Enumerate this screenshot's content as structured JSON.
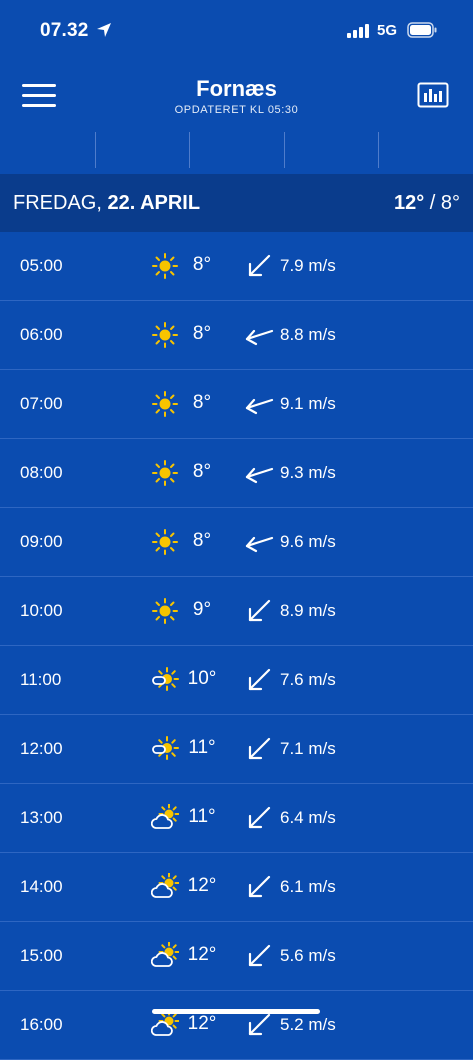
{
  "status_bar": {
    "time": "07.32",
    "network": "5G"
  },
  "header": {
    "title": "Fornæs",
    "subtitle": "OPDATERET KL 05:30",
    "menu_icon": "hamburger-icon",
    "chart_icon": "bar-chart-icon"
  },
  "day": {
    "name": "FREDAG, ",
    "date": "22. APRIL",
    "high": "12°",
    "separator": " / ",
    "low": "8°"
  },
  "colors": {
    "background": "#0b4cb0",
    "day_bar": "#0a3c8c",
    "row_divider": "#2e66c2",
    "sun": "#f7c400"
  },
  "hours": [
    {
      "time": "05:00",
      "icon": "sun-icon",
      "temp": "8°",
      "wind_dir": "southwest",
      "wind": "7.9 m/s"
    },
    {
      "time": "06:00",
      "icon": "sun-icon",
      "temp": "8°",
      "wind_dir": "west-southwest",
      "wind": "8.8 m/s"
    },
    {
      "time": "07:00",
      "icon": "sun-icon",
      "temp": "8°",
      "wind_dir": "west-southwest",
      "wind": "9.1 m/s"
    },
    {
      "time": "08:00",
      "icon": "sun-icon",
      "temp": "8°",
      "wind_dir": "west-southwest",
      "wind": "9.3 m/s"
    },
    {
      "time": "09:00",
      "icon": "sun-icon",
      "temp": "8°",
      "wind_dir": "west-southwest",
      "wind": "9.6 m/s"
    },
    {
      "time": "10:00",
      "icon": "sun-icon",
      "temp": "9°",
      "wind_dir": "southwest",
      "wind": "8.9 m/s"
    },
    {
      "time": "11:00",
      "icon": "sun-cloud-icon",
      "temp": "10°",
      "wind_dir": "southwest",
      "wind": "7.6 m/s"
    },
    {
      "time": "12:00",
      "icon": "sun-cloud-icon",
      "temp": "11°",
      "wind_dir": "southwest",
      "wind": "7.1 m/s"
    },
    {
      "time": "13:00",
      "icon": "partly-cloudy-icon",
      "temp": "11°",
      "wind_dir": "southwest",
      "wind": "6.4 m/s"
    },
    {
      "time": "14:00",
      "icon": "partly-cloudy-icon",
      "temp": "12°",
      "wind_dir": "southwest",
      "wind": "6.1 m/s"
    },
    {
      "time": "15:00",
      "icon": "partly-cloudy-icon",
      "temp": "12°",
      "wind_dir": "southwest",
      "wind": "5.6 m/s"
    },
    {
      "time": "16:00",
      "icon": "partly-cloudy-icon",
      "temp": "12°",
      "wind_dir": "southwest",
      "wind": "5.2 m/s"
    }
  ]
}
